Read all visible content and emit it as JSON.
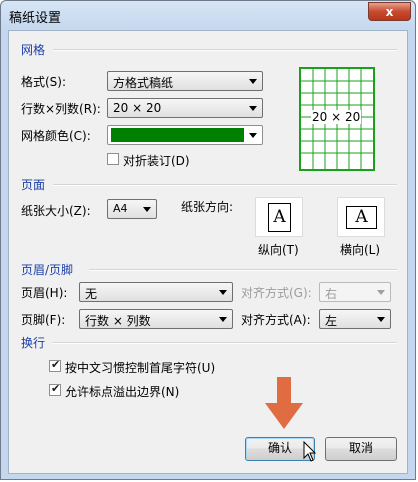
{
  "window": {
    "title": "稿纸设置",
    "close_label": "x"
  },
  "grid": {
    "section": "网格",
    "style_label": "格式(S):",
    "style_value": "方格式稿纸",
    "rowcol_label": "行数×列数(R):",
    "rowcol_value": "20 × 20",
    "color_label": "网格颜色(C):",
    "color_value": "#008000",
    "fold_label": "对折装订(D)",
    "fold_checked": false,
    "preview_text": "20 × 20"
  },
  "page": {
    "section": "页面",
    "size_label": "纸张大小(Z):",
    "size_value": "A4",
    "orientation_label": "纸张方向:",
    "portrait_label": "纵向(T)",
    "landscape_label": "横向(L)",
    "icon_letter": "A"
  },
  "header_footer": {
    "section": "页眉/页脚",
    "header_label": "页眉(H):",
    "header_value": "无",
    "header_align_label": "对齐方式(G):",
    "header_align_value": "右",
    "footer_label": "页脚(F):",
    "footer_value": "行数 × 列数",
    "footer_align_label": "对齐方式(A):",
    "footer_align_value": "左"
  },
  "line_break": {
    "section": "换行",
    "option1_label": "按中文习惯控制首尾字符(U)",
    "option1_checked": true,
    "option2_label": "允许标点溢出边界(N)",
    "option2_checked": true
  },
  "buttons": {
    "ok_label": "确认",
    "cancel_label": "取消"
  },
  "colors": {
    "grid_green": "#008000",
    "annotation_arrow": "#e06c42",
    "section_blue": "#1a3ea8"
  },
  "icons": [
    "close-icon",
    "dropdown-arrow-icon",
    "check-icon",
    "portrait-page-icon",
    "landscape-page-icon",
    "down-arrow-annotation-icon",
    "mouse-cursor-icon"
  ]
}
